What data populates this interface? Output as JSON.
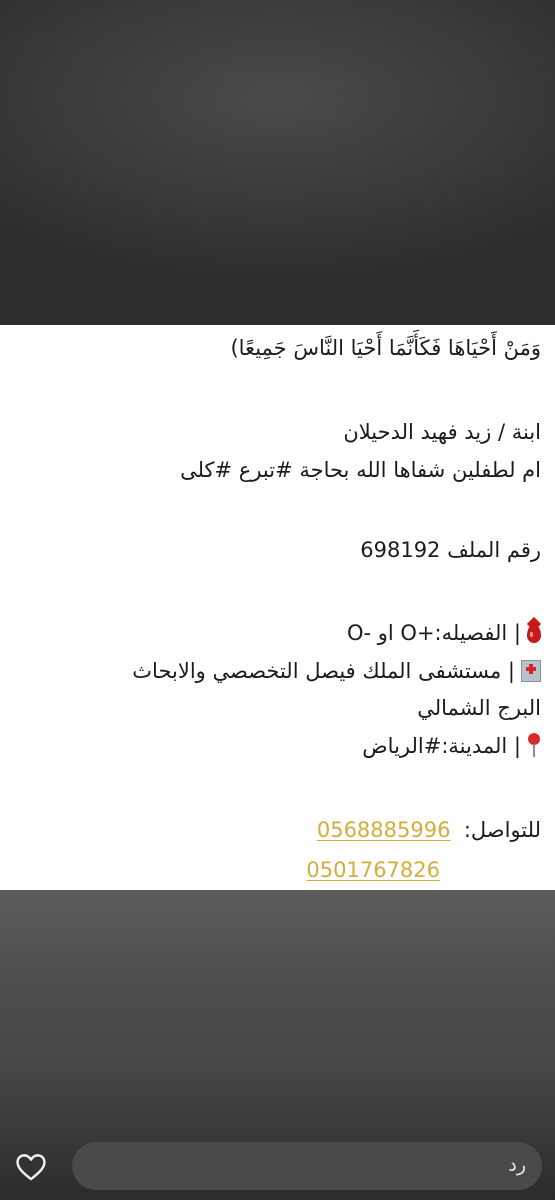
{
  "post": {
    "verse": "وَمَنْ أَحْيَاهَا فَكَأَنَّمَا أَحْيَا النَّاسَ جَمِيعًا)",
    "daughter_line": "ابنة /  زيد فهيد الدحيلان",
    "mother_line": "ام لطفلين شفاها الله بحاجة #تبرع #كلى",
    "file_number": "رقم الملف 698192",
    "blood_type": "| الفصيله:+O او -O",
    "hospital": "| مستشفى الملك فيصل التخصصي والابحاث",
    "tower": "البرج الشمالي",
    "city": "| المدينة:#الرياض",
    "contact_label": "للتواصل:",
    "phone_1": "0568885996",
    "phone_2": "0501767826",
    "icons": {
      "blood": "blood-drop-icon",
      "hospital": "hospital-icon",
      "location": "round-pushpin-icon"
    },
    "link_color": "#d4ad3c"
  },
  "reply_bar": {
    "placeholder": "رد",
    "heart_icon": "heart-icon"
  }
}
